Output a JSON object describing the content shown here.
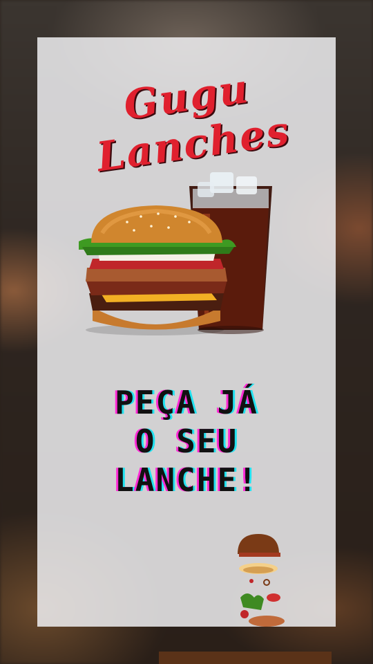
{
  "brand": {
    "line1": "Gugu",
    "line2": "Lanches"
  },
  "headline": {
    "line1": "PEÇA JÁ",
    "line2": "O SEU",
    "line3": "LANCHE!"
  },
  "colors": {
    "brand_red": "#e0202e",
    "panel": "#eeeef0",
    "glitch_magenta": "#ff2bd6",
    "glitch_cyan": "#21e2f0"
  },
  "images": {
    "hero": "burger-and-soda-image",
    "bottom": "floating-burger-ingredients-image"
  }
}
